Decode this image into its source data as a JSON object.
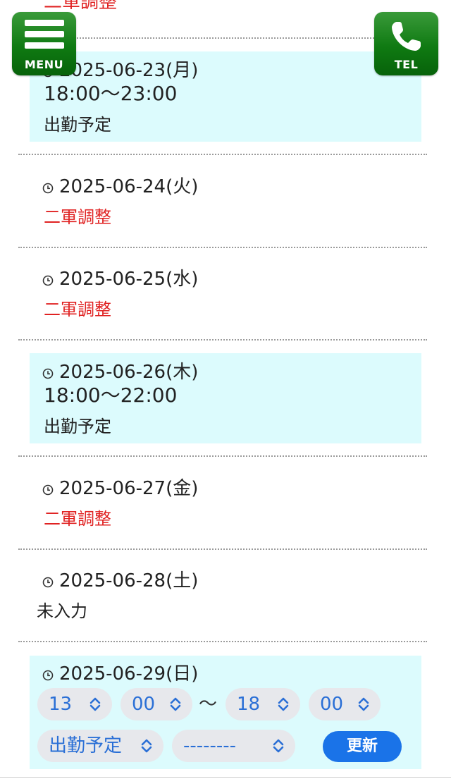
{
  "top_status": "二軍調整",
  "menu_button": {
    "label": "MENU"
  },
  "tel_button": {
    "label": "TEL"
  },
  "entries": [
    {
      "date": "2025-06-23(月)",
      "time": "18:00～23:00",
      "status": "出勤予定"
    },
    {
      "date": "2025-06-24(火)",
      "status": "二軍調整"
    },
    {
      "date": "2025-06-25(水)",
      "status": "二軍調整"
    },
    {
      "date": "2025-06-26(木)",
      "time": "18:00～22:00",
      "status": "出勤予定"
    },
    {
      "date": "2025-06-27(金)",
      "status": "二軍調整"
    },
    {
      "date": "2025-06-28(土)",
      "status": "未入力"
    },
    {
      "date": "2025-06-29(日)"
    }
  ],
  "edit_form": {
    "start_hour": "13",
    "start_minute": "00",
    "separator": "～",
    "end_hour": "18",
    "end_minute": "00",
    "status_select": "出勤予定",
    "sub_select": "--------",
    "update_label": "更新"
  },
  "colors": {
    "highlight_bg": "#dcfbfd",
    "red_text": "#e02222",
    "button_green": "#0f7a12",
    "accent_blue": "#1a73e8"
  },
  "icons": {
    "menu": "hamburger-icon",
    "tel": "phone-icon",
    "date": "clock-icon",
    "select": "chevron-updown-icon"
  }
}
